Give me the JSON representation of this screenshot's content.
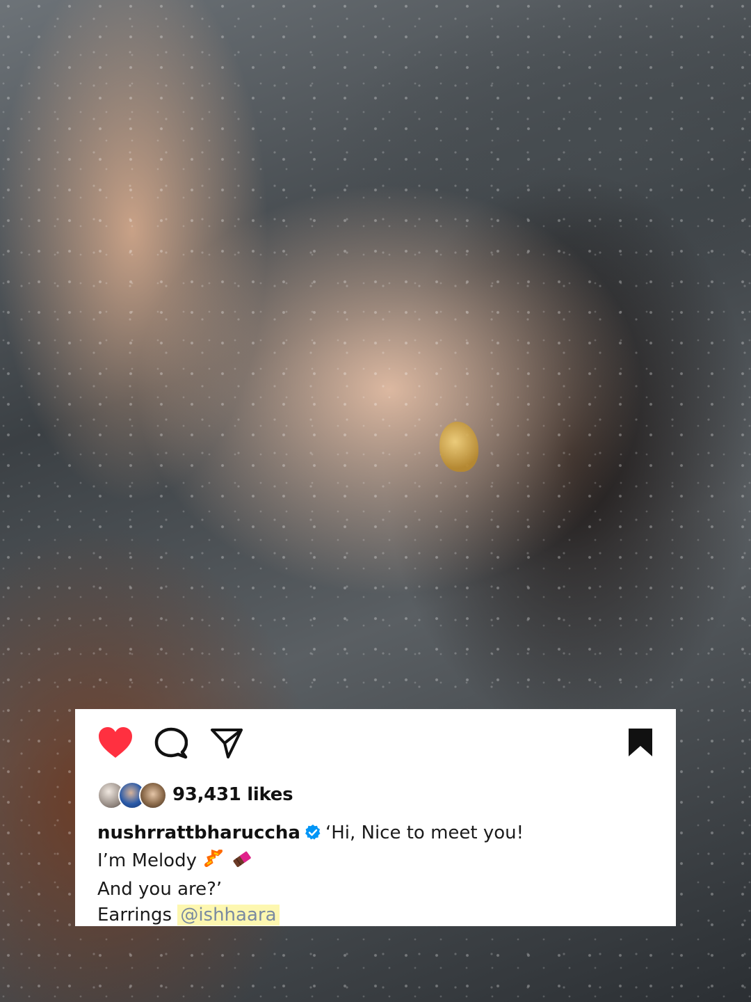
{
  "post": {
    "icons": {
      "like": "heart-filled-icon",
      "comment": "comment-bubble-icon",
      "share": "paper-plane-icon",
      "save": "bookmark-filled-icon"
    },
    "colors": {
      "heart": "#ff3040",
      "text": "#111111",
      "mention_highlight": "#fdf7b0",
      "mention_text": "#7a8aa0",
      "verified": "#0095f6"
    },
    "likes_text": "93,431 likes",
    "username": "nushrrattbharuccha",
    "caption": {
      "line1": "‘Hi, Nice to meet you!",
      "line2": "I’m Melody",
      "line3": "And you are?’",
      "line4_prefix": "Earrings ",
      "mention": "@ishhaara"
    }
  }
}
